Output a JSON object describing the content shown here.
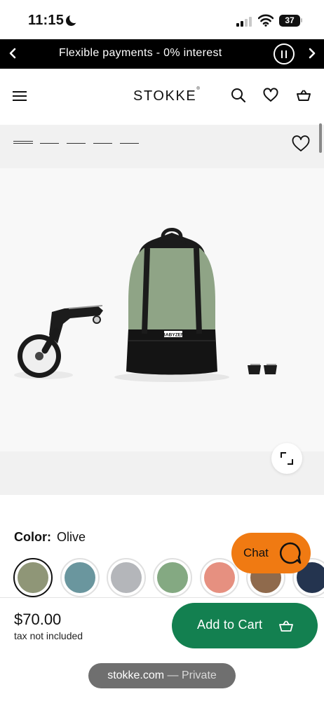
{
  "status_bar": {
    "time": "11:15",
    "battery": "37",
    "moon_icon": "moon-icon",
    "signal_icon": "cellular-signal-icon",
    "wifi_icon": "wifi-icon"
  },
  "promo": {
    "text": "Flexible payments - 0% interest",
    "prev_icon": "chevron-left-icon",
    "pause_icon": "pause-icon",
    "next_icon": "chevron-right-icon"
  },
  "header": {
    "logo": "STOKKE",
    "logo_mark": "®",
    "menu_icon": "hamburger-menu-icon",
    "search_icon": "search-icon",
    "wishlist_icon": "heart-icon",
    "cart_icon": "basket-icon"
  },
  "product": {
    "image_brand_label": "BABYZEN",
    "bag_color": "#8fa486",
    "expand_icon": "expand-icon",
    "wishlist_icon": "heart-icon"
  },
  "color": {
    "label": "Color:",
    "selected": "Olive",
    "swatches": [
      {
        "color": "#8f9677",
        "selected": true
      },
      {
        "color": "#6a969e",
        "selected": false
      },
      {
        "color": "#b4b6ba",
        "selected": false
      },
      {
        "color": "#84a982",
        "selected": false
      },
      {
        "color": "#e69080",
        "selected": false
      },
      {
        "color": "#8f6a4c",
        "selected": false
      },
      {
        "color": "#24344f",
        "selected": false
      }
    ]
  },
  "chat": {
    "label": "Chat",
    "icon": "chat-bubble-icon",
    "color": "#f07a12"
  },
  "purchase": {
    "price": "$70.00",
    "tax_note": "tax not included",
    "add_to_cart": "Add to Cart",
    "cart_icon": "basket-icon",
    "button_color": "#138050"
  },
  "browser": {
    "domain": "stokke.com",
    "mode": " — Private"
  }
}
